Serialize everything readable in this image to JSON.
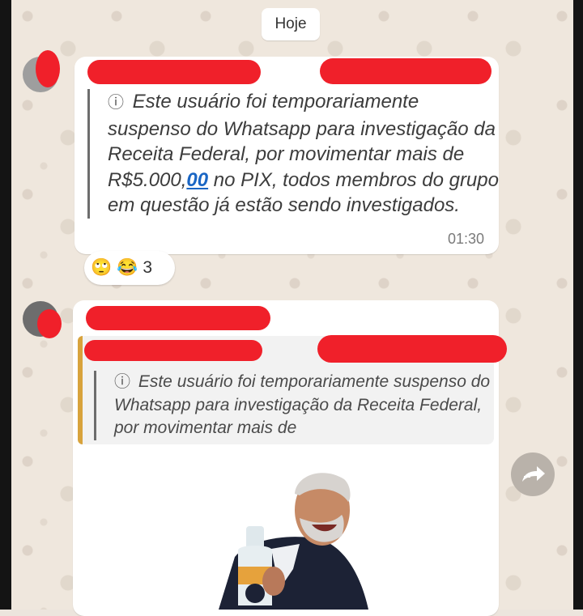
{
  "date_chip": "Hoje",
  "message_1": {
    "text_before_link": "Este usuário foi temporariamente suspenso do Whatsapp para investigação da Receita Federal, por movimentar mais de R$5.000,",
    "link_text": "00",
    "text_after_link": " no PIX, todos membros do grupo em questão já estão sendo investigados.",
    "time": "01:30"
  },
  "reactions": {
    "emoji_1": "🙄",
    "emoji_2": "😂",
    "count": "3"
  },
  "message_2": {
    "quoted_text": "Este usuário foi temporariamente suspenso do Whatsapp para investigação da Receita Federal, por movimentar mais de"
  },
  "info_icon": "ⓘ",
  "colors": {
    "redaction": "#f0202a",
    "link": "#1a66c4",
    "quote_bar": "#d8a33c"
  }
}
